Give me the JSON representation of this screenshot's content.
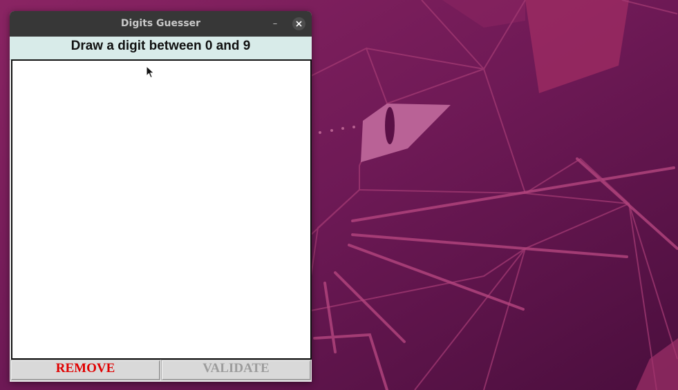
{
  "window": {
    "title": "Digits Guesser",
    "minimize_label": "–"
  },
  "header": {
    "text": "Draw a digit between 0 and 9"
  },
  "buttons": {
    "remove_label": "REMOVE",
    "validate_label": "VALIDATE",
    "remove_color": "#e00000",
    "validate_state": "disabled"
  },
  "icons": {
    "close": "close-icon",
    "cursor": "mouse-pointer-icon"
  }
}
